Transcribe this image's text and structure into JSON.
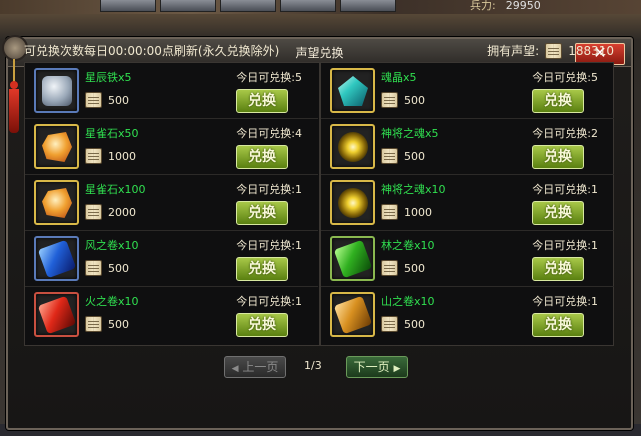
{
  "header": {
    "power_label": "兵力:",
    "power_value": "29950"
  },
  "dialog": {
    "title": "声望兑换",
    "close_label": "✕",
    "refresh_note": "可兑换次数每日00:00:00点刷新(永久兑换除外)",
    "owned_label": "拥有声望:",
    "owned_value": "188310"
  },
  "items": [
    {
      "name": "星辰铁x5",
      "cost": "500",
      "limit": "今日可兑换:5",
      "button": "兑换",
      "icon": "star-iron-icon"
    },
    {
      "name": "魂晶x5",
      "cost": "500",
      "limit": "今日可兑换:5",
      "button": "兑换",
      "icon": "soul-crystal-icon"
    },
    {
      "name": "星雀石x50",
      "cost": "1000",
      "limit": "今日可兑换:4",
      "button": "兑换",
      "icon": "star-stone-icon"
    },
    {
      "name": "神将之魂x5",
      "cost": "500",
      "limit": "今日可兑换:2",
      "button": "兑换",
      "icon": "general-soul-icon"
    },
    {
      "name": "星雀石x100",
      "cost": "2000",
      "limit": "今日可兑换:1",
      "button": "兑换",
      "icon": "star-stone-icon"
    },
    {
      "name": "神将之魂x10",
      "cost": "1000",
      "limit": "今日可兑换:1",
      "button": "兑换",
      "icon": "general-soul-icon"
    },
    {
      "name": "风之卷x10",
      "cost": "500",
      "limit": "今日可兑换:1",
      "button": "兑换",
      "icon": "wind-scroll-icon"
    },
    {
      "name": "林之卷x10",
      "cost": "500",
      "limit": "今日可兑换:1",
      "button": "兑换",
      "icon": "forest-scroll-icon"
    },
    {
      "name": "火之卷x10",
      "cost": "500",
      "limit": "今日可兑换:1",
      "button": "兑换",
      "icon": "fire-scroll-icon"
    },
    {
      "name": "山之卷x10",
      "cost": "500",
      "limit": "今日可兑换:1",
      "button": "兑换",
      "icon": "mountain-scroll-icon"
    }
  ],
  "pager": {
    "prev_label": "上一页",
    "next_label": "下一页",
    "page_text": "1/3",
    "prev_arrow": "◀",
    "next_arrow": "▶"
  },
  "colors": {
    "item_name": "#30e050",
    "button_green": "#5a8010",
    "frame_gold": "#d8b848"
  }
}
